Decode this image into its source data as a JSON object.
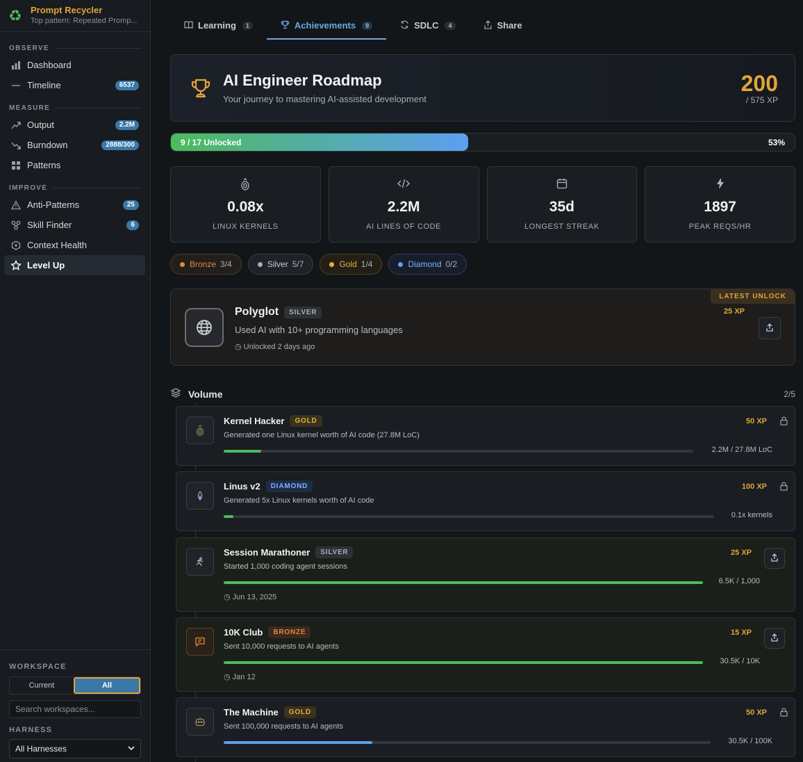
{
  "brand": {
    "title": "Prompt Recycler",
    "subtitle": "Top pattern: Repeated Promp...",
    "accent": "#e2a43a"
  },
  "sidebar": {
    "sections": [
      {
        "title": "OBSERVE",
        "items": [
          {
            "label": "Dashboard",
            "icon": "bar-chart-icon",
            "badge": ""
          },
          {
            "label": "Timeline",
            "icon": "timeline-icon",
            "badge": "6537"
          }
        ]
      },
      {
        "title": "MEASURE",
        "items": [
          {
            "label": "Output",
            "icon": "trend-up-icon",
            "badge": "2.2M"
          },
          {
            "label": "Burndown",
            "icon": "trend-down-icon",
            "badge": "2888/300"
          },
          {
            "label": "Patterns",
            "icon": "grid-icon",
            "badge": ""
          }
        ]
      },
      {
        "title": "IMPROVE",
        "items": [
          {
            "label": "Anti-Patterns",
            "icon": "warning-icon",
            "badge": "25"
          },
          {
            "label": "Skill Finder",
            "icon": "nodes-icon",
            "badge": "6"
          },
          {
            "label": "Context Health",
            "icon": "health-icon",
            "badge": ""
          },
          {
            "label": "Level Up",
            "icon": "star-icon",
            "badge": "",
            "active": true
          }
        ]
      }
    ],
    "workspace": {
      "label": "WORKSPACE",
      "options": [
        "Current",
        "All"
      ],
      "selected": "All",
      "search_placeholder": "Search workspaces..."
    },
    "harness": {
      "label": "HARNESS",
      "selected": "All Harnesses"
    }
  },
  "tabs": [
    {
      "label": "Learning",
      "count": "1",
      "icon": "book-icon"
    },
    {
      "label": "Achievements",
      "count": "9",
      "icon": "trophy-icon",
      "active": true
    },
    {
      "label": "SDLC",
      "count": "4",
      "icon": "refresh-icon"
    },
    {
      "label": "Share",
      "count": "",
      "icon": "share-icon"
    }
  ],
  "hero": {
    "title": "AI Engineer Roadmap",
    "subtitle": "Your journey to mastering AI-assisted development",
    "xp": "200",
    "xp_max": "/ 575 XP"
  },
  "progress": {
    "label": "9 / 17 Unlocked",
    "percent_label": "53%",
    "fraction": 0.53
  },
  "stats": [
    {
      "value": "0.08x",
      "label": "LINUX KERNELS",
      "icon": "kernel-icon"
    },
    {
      "value": "2.2M",
      "label": "AI LINES OF CODE",
      "icon": "code-icon"
    },
    {
      "value": "35d",
      "label": "LONGEST STREAK",
      "icon": "calendar-icon"
    },
    {
      "value": "1897",
      "label": "PEAK REQS/HR",
      "icon": "bolt-icon"
    }
  ],
  "tiers": [
    {
      "name": "Bronze",
      "count": "3/4",
      "color": "#e08a3a",
      "cls": "bronze"
    },
    {
      "name": "Silver",
      "count": "5/7",
      "color": "#a9aeb5",
      "cls": "silver"
    },
    {
      "name": "Gold",
      "count": "1/4",
      "color": "#e2b23a",
      "cls": "gold"
    },
    {
      "name": "Diamond",
      "count": "0/2",
      "color": "#5b9ff0",
      "cls": "diamond"
    }
  ],
  "latest": {
    "tag": "LATEST UNLOCK",
    "name": "Polyglot",
    "tier": "SILVER",
    "description": "Used AI with 10+ programming languages",
    "when": "Unlocked 2 days ago",
    "xp": "25 XP",
    "icon": "globe-icon"
  },
  "group": {
    "name": "Volume",
    "count": "2/5"
  },
  "achievements": [
    {
      "name": "Kernel Hacker",
      "tier": "GOLD",
      "tier_cls": "gold",
      "description": "Generated one Linux kernel worth of AI code (27.8M LoC)",
      "progress_text": "2.2M / 27.8M LoC",
      "progress": 0.08,
      "xp": "50 XP",
      "unlocked": false,
      "date": "",
      "icon": "kernel-icon",
      "bar_color": "#4cbb5c"
    },
    {
      "name": "Linus v2",
      "tier": "DIAMOND",
      "tier_cls": "diamond",
      "description": "Generated 5x Linux kernels worth of AI code",
      "progress_text": "0.1x kernels",
      "progress": 0.02,
      "xp": "100 XP",
      "unlocked": false,
      "date": "",
      "icon": "flame-icon",
      "bar_color": "#4cbb5c"
    },
    {
      "name": "Session Marathoner",
      "tier": "SILVER",
      "tier_cls": "silver",
      "description": "Started 1,000 coding agent sessions",
      "progress_text": "6.5K / 1,000",
      "progress": 1.0,
      "xp": "25 XP",
      "unlocked": true,
      "date": "Jun 13, 2025",
      "icon": "runner-icon",
      "bar_color": "#4cbb5c"
    },
    {
      "name": "10K Club",
      "tier": "BRONZE",
      "tier_cls": "bronze",
      "description": "Sent 10,000 requests to AI agents",
      "progress_text": "30.5K / 10K",
      "progress": 1.0,
      "xp": "15 XP",
      "unlocked": true,
      "date": "Jan 12",
      "icon": "chat-icon",
      "bar_color": "#4cbb5c"
    },
    {
      "name": "The Machine",
      "tier": "GOLD",
      "tier_cls": "gold",
      "description": "Sent 100,000 requests to AI agents",
      "progress_text": "30.5K / 100K",
      "progress": 0.305,
      "xp": "50 XP",
      "unlocked": false,
      "date": "",
      "icon": "robot-icon",
      "bar_color": "#5b9ff0"
    }
  ]
}
